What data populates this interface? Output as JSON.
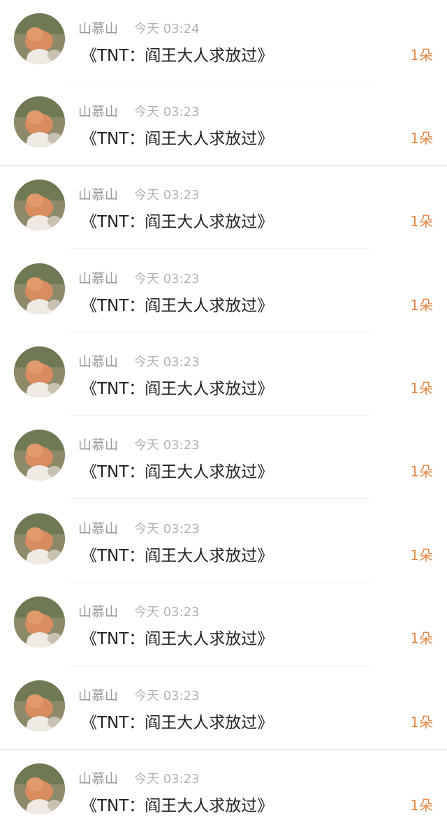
{
  "user": {
    "name": "山慕山"
  },
  "gift": {
    "message": "《TNT：阎王大人求放过》",
    "count_label": "1朵"
  },
  "rows": [
    {
      "time": "今天 03:24"
    },
    {
      "time": "今天 03:23"
    },
    {
      "time": "今天 03:23"
    },
    {
      "time": "今天 03:23"
    },
    {
      "time": "今天 03:23"
    },
    {
      "time": "今天 03:23"
    },
    {
      "time": "今天 03:23"
    },
    {
      "time": "今天 03:23"
    },
    {
      "time": "今天 03:23"
    },
    {
      "time": "今天 03:23"
    }
  ],
  "colors": {
    "count": "#e5894a",
    "name": "#9a9a9a",
    "time": "#b3b3b3",
    "message": "#222222"
  }
}
